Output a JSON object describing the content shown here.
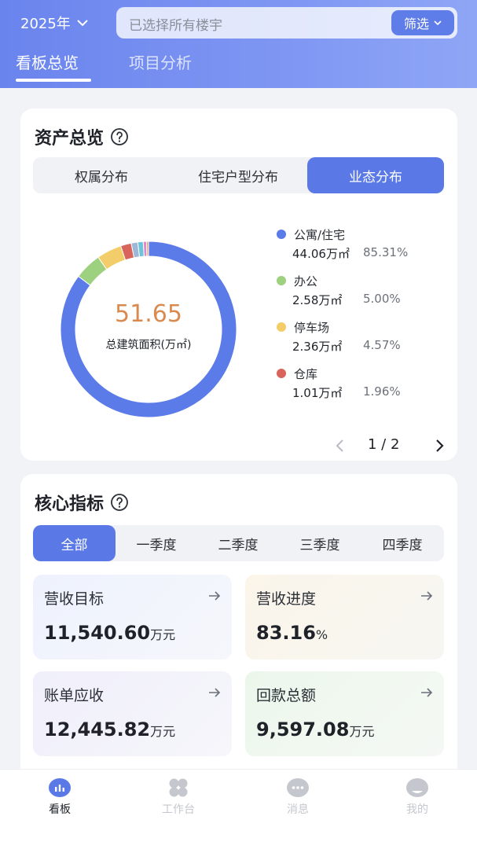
{
  "header": {
    "year_label": "2025年",
    "search_text": "已选择所有楼宇",
    "filter_label": "筛选",
    "tabs": [
      {
        "label": "看板总览",
        "active": true
      },
      {
        "label": "项目分析",
        "active": false
      }
    ]
  },
  "asset_card": {
    "title": "资产总览",
    "segments": [
      {
        "label": "权属分布",
        "active": false
      },
      {
        "label": "住宅户型分布",
        "active": false
      },
      {
        "label": "业态分布",
        "active": true
      }
    ],
    "total_value": "51.65",
    "total_label": "总建筑面积(万㎡)",
    "legend": [
      {
        "name": "公寓/住宅",
        "area": "44.06万㎡",
        "pct": "85.31%",
        "color": "#5b7be9"
      },
      {
        "name": "办公",
        "area": "2.58万㎡",
        "pct": "5.00%",
        "color": "#9dd07f"
      },
      {
        "name": "停车场",
        "area": "2.36万㎡",
        "pct": "4.57%",
        "color": "#f2cd6a"
      },
      {
        "name": "仓库",
        "area": "1.01万㎡",
        "pct": "1.96%",
        "color": "#d9645b"
      }
    ],
    "pager": "1 / 2"
  },
  "chart_data": {
    "type": "pie",
    "slices": [
      {
        "label": "公寓/住宅",
        "value": 85.31,
        "color": "#5b7be9"
      },
      {
        "label": "办公",
        "value": 5.0,
        "color": "#9dd07f"
      },
      {
        "label": "停车场",
        "value": 4.57,
        "color": "#f2cd6a"
      },
      {
        "label": "仓库",
        "value": 1.96,
        "color": "#d9645b"
      },
      {
        "value": 1.2,
        "color": "#9fb7d6"
      },
      {
        "value": 1.0,
        "color": "#6cc4d9"
      },
      {
        "value": 0.6,
        "color": "#d98ad0"
      },
      {
        "value": 0.36,
        "color": "#f0a060"
      }
    ]
  },
  "kpi_card": {
    "title": "核心指标",
    "segments": [
      {
        "label": "全部",
        "active": true
      },
      {
        "label": "一季度",
        "active": false
      },
      {
        "label": "二季度",
        "active": false
      },
      {
        "label": "三季度",
        "active": false
      },
      {
        "label": "四季度",
        "active": false
      }
    ],
    "tiles": [
      {
        "label": "营收目标",
        "value": "11,540.60",
        "unit": "万元"
      },
      {
        "label": "营收进度",
        "value": "83.16",
        "unit": "%"
      },
      {
        "label": "账单应收",
        "value": "12,445.82",
        "unit": "万元"
      },
      {
        "label": "回款总额",
        "value": "9,597.08",
        "unit": "万元"
      }
    ]
  },
  "bottom_nav": [
    {
      "label": "看板",
      "active": true,
      "icon": "dashboard-icon"
    },
    {
      "label": "工作台",
      "active": false,
      "icon": "apps-icon"
    },
    {
      "label": "消息",
      "active": false,
      "icon": "message-icon"
    },
    {
      "label": "我的",
      "active": false,
      "icon": "profile-icon"
    }
  ],
  "colors": {
    "accent": "#5a79e6",
    "value_orange": "#d98a4e"
  }
}
